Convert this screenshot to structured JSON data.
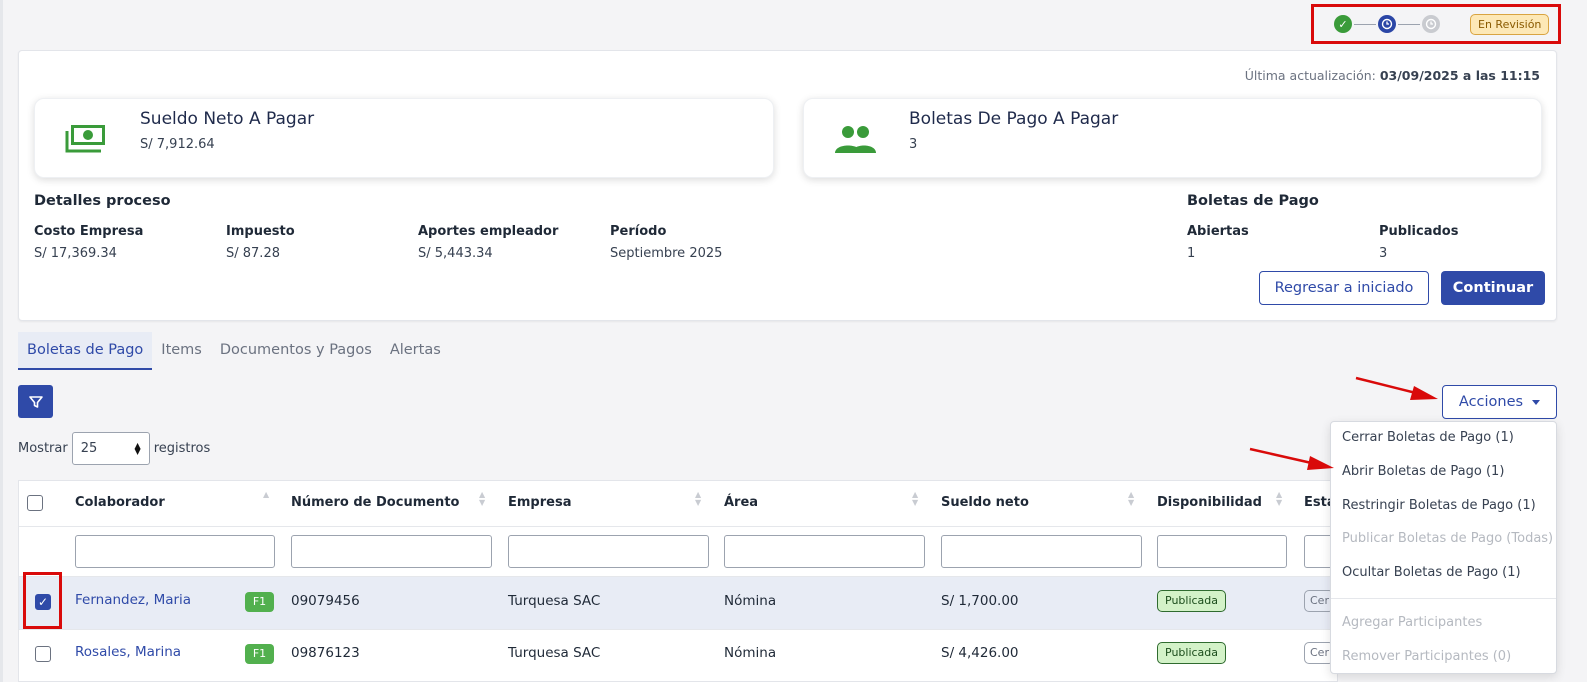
{
  "status": {
    "badge": "En Revisión",
    "steps": [
      "done",
      "current",
      "pending"
    ]
  },
  "header": {
    "last_update_label": "Última actualización:",
    "last_update_value": "03/09/2025 a las 11:15"
  },
  "summary_cards": [
    {
      "title": "Sueldo Neto A Pagar",
      "value": "S/ 7,912.64",
      "icon": "money-icon"
    },
    {
      "title": "Boletas De Pago A Pagar",
      "value": "3",
      "icon": "people-icon"
    }
  ],
  "process": {
    "title": "Detalles proceso",
    "fields": [
      {
        "label": "Costo Empresa",
        "value": "S/ 17,369.34"
      },
      {
        "label": "Impuesto",
        "value": "S/ 87.28"
      },
      {
        "label": "Aportes empleador",
        "value": "S/ 5,443.34"
      },
      {
        "label": "Período",
        "value": "Septiembre 2025"
      }
    ]
  },
  "boletas": {
    "title": "Boletas de Pago",
    "fields": [
      {
        "label": "Abiertas",
        "value": "1"
      },
      {
        "label": "Publicados",
        "value": "3"
      }
    ]
  },
  "actions": {
    "back_label": "Regresar a iniciado",
    "continue_label": "Continuar"
  },
  "tabs": [
    "Boletas de Pago",
    "Items",
    "Documentos y Pagos",
    "Alertas"
  ],
  "list_controls": {
    "show_label": "Mostrar",
    "page_size": "25",
    "records_label": "registros",
    "actions_label": "Acciones"
  },
  "table": {
    "columns": [
      "Colaborador",
      "Número de Documento",
      "Empresa",
      "Área",
      "Sueldo neto",
      "Disponibilidad",
      "Esta"
    ],
    "rows": [
      {
        "checked": true,
        "name": "Fernandez, Maria",
        "tag": "F1",
        "document": "09079456",
        "company": "Turquesa SAC",
        "area": "Nómina",
        "salary": "S/ 1,700.00",
        "availability": "Publicada",
        "state": "Cer"
      },
      {
        "checked": false,
        "name": "Rosales, Marina",
        "tag": "F1",
        "document": "09876123",
        "company": "Turquesa SAC",
        "area": "Nómina",
        "salary": "S/ 4,426.00",
        "availability": "Publicada",
        "state": "Cer"
      }
    ]
  },
  "dropdown": {
    "items": [
      {
        "label": "Cerrar Boletas de Pago (1)",
        "disabled": false
      },
      {
        "label": "Abrir Boletas de Pago (1)",
        "disabled": false
      },
      {
        "label": "Restringir Boletas de Pago (1)",
        "disabled": false
      },
      {
        "label": "Publicar Boletas de Pago (Todas)",
        "disabled": true
      },
      {
        "label": "Ocultar Boletas de Pago (1)",
        "disabled": false
      },
      {
        "label": "Agregar Participantes",
        "disabled": true
      },
      {
        "label": "Remover Participantes (0)",
        "disabled": true
      }
    ]
  },
  "colors": {
    "primary": "#2f4aa8",
    "success": "#3a9b3a",
    "annotation": "#d90a0a"
  }
}
